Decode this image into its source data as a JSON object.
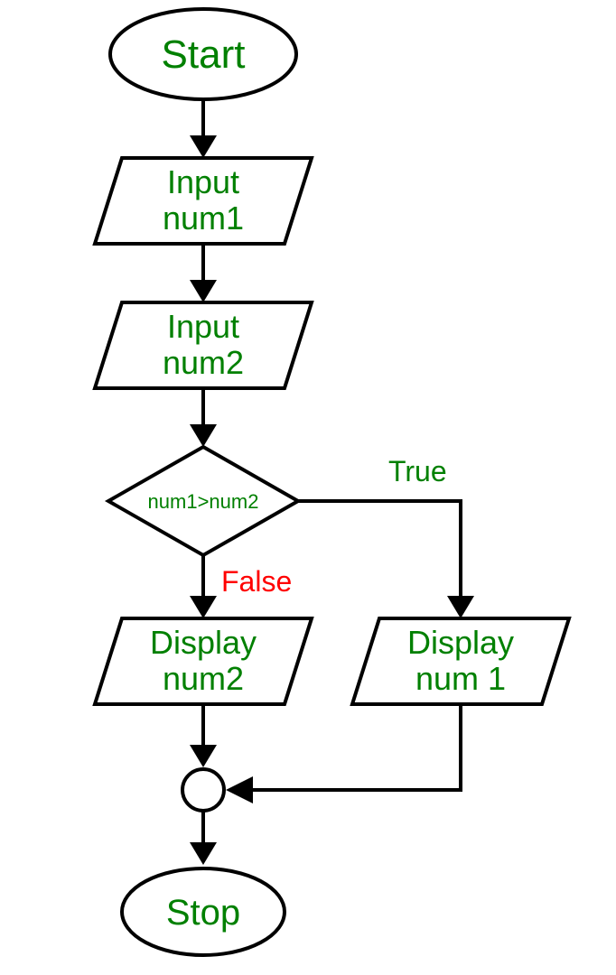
{
  "nodes": {
    "start": "Start",
    "input1_line1": "Input",
    "input1_line2": "num1",
    "input2_line1": "Input",
    "input2_line2": "num2",
    "decision": "num1>num2",
    "dispL_line1": "Display",
    "dispL_line2": "num2",
    "dispR_line1": "Display",
    "dispR_line2": "num 1",
    "stop": "Stop"
  },
  "edges": {
    "true": "True",
    "false": "False"
  }
}
